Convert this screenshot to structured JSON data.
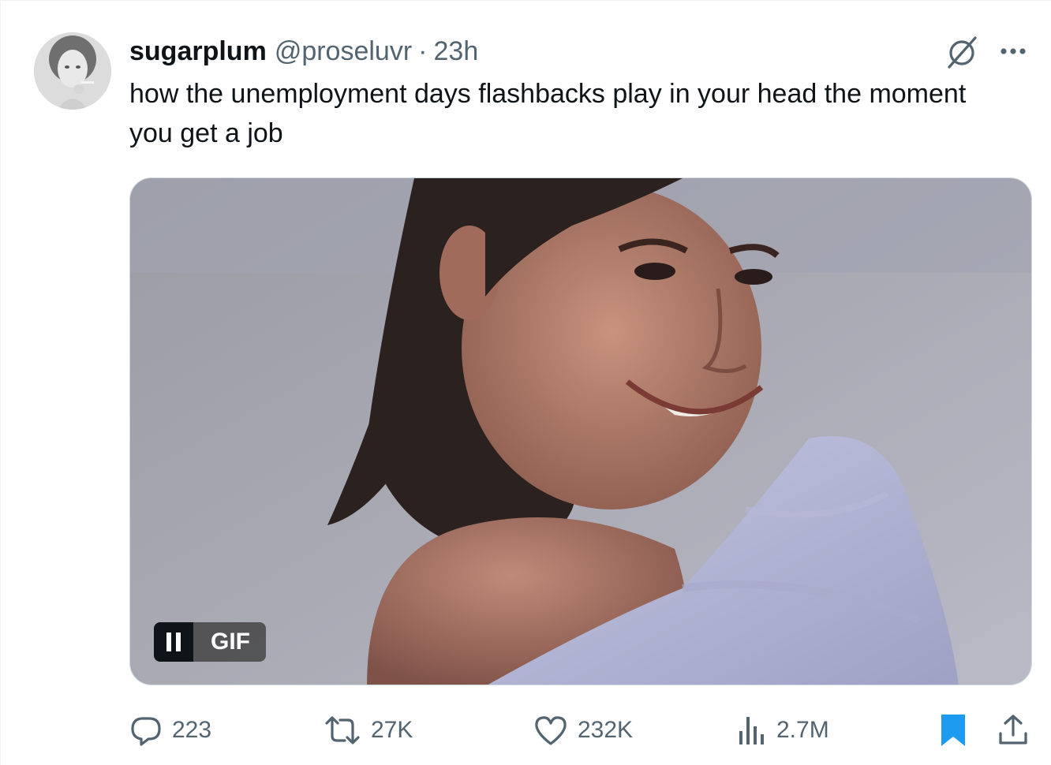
{
  "tweet": {
    "display_name": "sugarplum",
    "handle": "@proseluvr",
    "separator": "·",
    "time": "23h",
    "text": "how the unemployment days flashbacks play in your head the moment you get a job",
    "media": {
      "badge_label": "GIF"
    },
    "actions": {
      "replies": "223",
      "reposts": "27K",
      "likes": "232K",
      "views": "2.7M"
    }
  },
  "colors": {
    "text_primary": "#0f1419",
    "text_secondary": "#536471",
    "bookmark_active": "#1d9bf0"
  },
  "icons": [
    "grok-icon",
    "more-options-icon",
    "pause-icon",
    "reply-icon",
    "repost-icon",
    "like-icon",
    "views-icon",
    "bookmark-icon",
    "share-icon"
  ]
}
